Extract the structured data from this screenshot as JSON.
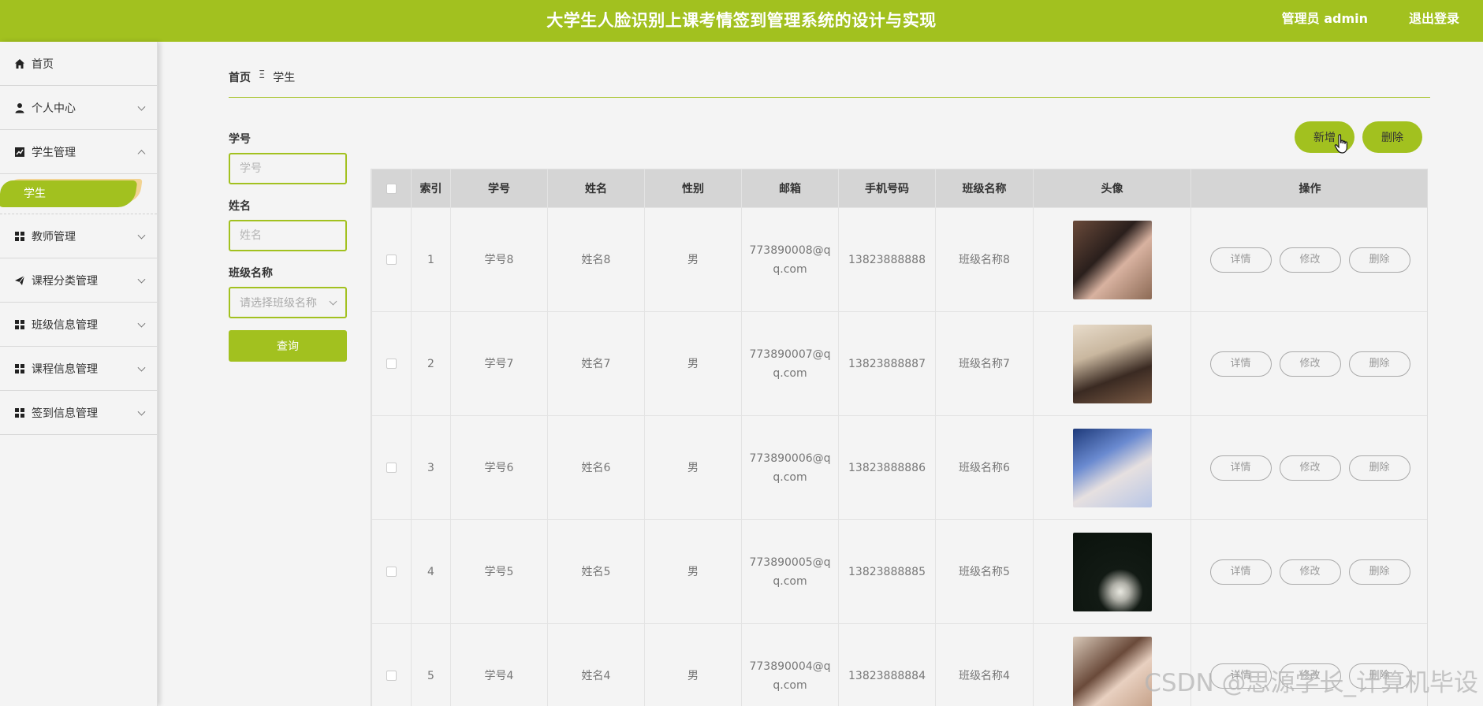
{
  "header": {
    "title": "大学生人脸识别上课考情签到管理系统的设计与实现",
    "user": "管理员 admin",
    "logout": "退出登录"
  },
  "colors": {
    "brand": "#a2c11f",
    "accent": "#f2d392"
  },
  "sidebar": {
    "items": [
      {
        "label": "首页",
        "icon": "home-icon"
      },
      {
        "label": "个人中心",
        "icon": "user-icon"
      },
      {
        "label": "学生管理",
        "icon": "chart-icon",
        "expanded": true,
        "sub": [
          {
            "label": "学生",
            "active": true
          }
        ]
      },
      {
        "label": "教师管理",
        "icon": "grid-icon"
      },
      {
        "label": "课程分类管理",
        "icon": "send-icon"
      },
      {
        "label": "班级信息管理",
        "icon": "grid-icon"
      },
      {
        "label": "课程信息管理",
        "icon": "grid-icon"
      },
      {
        "label": "签到信息管理",
        "icon": "grid-icon"
      }
    ]
  },
  "breadcrumb": {
    "home": "首页",
    "separator": "Ξ",
    "current": "学生"
  },
  "search": {
    "student_no_label": "学号",
    "student_no_placeholder": "学号",
    "name_label": "姓名",
    "name_placeholder": "姓名",
    "class_label": "班级名称",
    "class_placeholder": "请选择班级名称",
    "query_button": "查询"
  },
  "actions": {
    "add": "新增",
    "delete": "删除"
  },
  "table": {
    "columns": [
      "索引",
      "学号",
      "姓名",
      "性别",
      "邮箱",
      "手机号码",
      "班级名称",
      "头像",
      "操作"
    ],
    "row_buttons": {
      "detail": "详情",
      "edit": "修改",
      "delete": "删除"
    },
    "rows": [
      {
        "index": "1",
        "student_no": "学号8",
        "name": "姓名8",
        "gender": "男",
        "email_1": "773890008@q",
        "email_2": "q.com",
        "phone": "13823888888",
        "class": "班级名称8",
        "avatar": "photo-icon"
      },
      {
        "index": "2",
        "student_no": "学号7",
        "name": "姓名7",
        "gender": "男",
        "email_1": "773890007@q",
        "email_2": "q.com",
        "phone": "13823888887",
        "class": "班级名称7",
        "avatar": "photo-icon"
      },
      {
        "index": "3",
        "student_no": "学号6",
        "name": "姓名6",
        "gender": "男",
        "email_1": "773890006@q",
        "email_2": "q.com",
        "phone": "13823888886",
        "class": "班级名称6",
        "avatar": "photo-icon"
      },
      {
        "index": "4",
        "student_no": "学号5",
        "name": "姓名5",
        "gender": "男",
        "email_1": "773890005@q",
        "email_2": "q.com",
        "phone": "13823888885",
        "class": "班级名称5",
        "avatar": "photo-icon"
      },
      {
        "index": "5",
        "student_no": "学号4",
        "name": "姓名4",
        "gender": "男",
        "email_1": "773890004@q",
        "email_2": "q.com",
        "phone": "13823888884",
        "class": "班级名称4",
        "avatar": "photo-icon"
      }
    ]
  },
  "watermark": "CSDN @思源学长_计算机毕设"
}
